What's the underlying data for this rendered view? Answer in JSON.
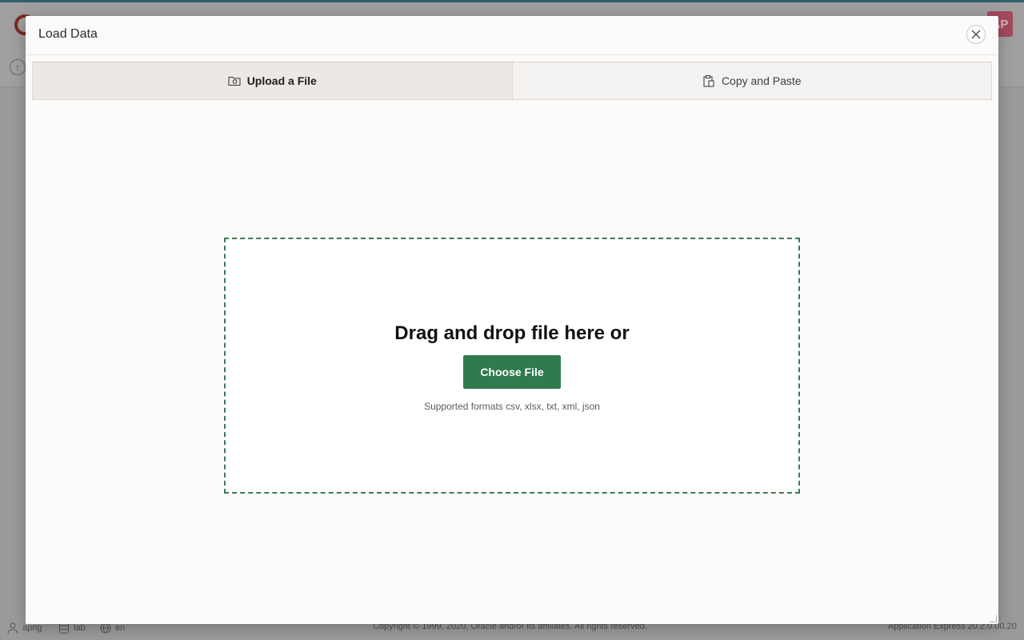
{
  "background": {
    "app_avatar_text": "AP",
    "footer": {
      "user": "apng",
      "workspace": "lab",
      "language": "en",
      "copyright": "Copyright © 1999, 2020, Oracle and/or its affiliates. All rights reserved.",
      "version": "Application Express 20.2.0.00.20"
    }
  },
  "dialog": {
    "title": "Load Data",
    "close_label": "Close",
    "tabs": [
      {
        "label": "Upload a File",
        "icon": "folder-upload-icon",
        "active": true
      },
      {
        "label": "Copy and Paste",
        "icon": "clipboard-icon",
        "active": false
      }
    ],
    "dropzone": {
      "heading": "Drag and drop file here or",
      "button_label": "Choose File",
      "hint": "Supported formats csv, xlsx, txt, xml, json"
    }
  },
  "colors": {
    "accent_green": "#2f7a4e",
    "dropzone_border": "#3a7a52",
    "dialog_bg": "#fcfbfa"
  }
}
